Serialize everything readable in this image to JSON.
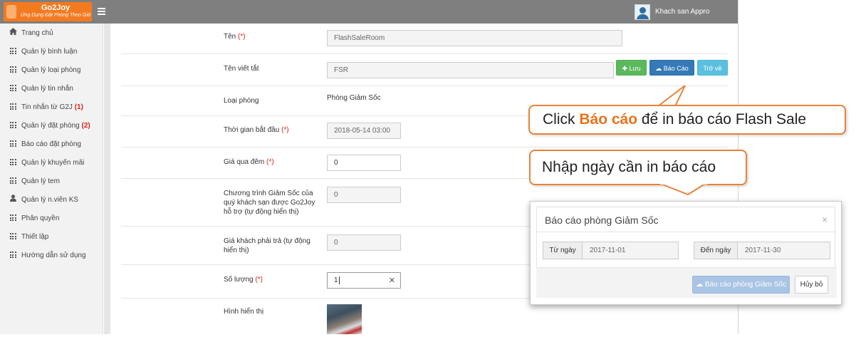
{
  "header": {
    "logo_brand": "Go2Joy",
    "logo_tagline": "Ứng Dụng Đặt Phòng Theo Giờ",
    "username": "Khach san Appro"
  },
  "sidebar": {
    "items": [
      {
        "label": "Trang chủ",
        "icon": "home-icon"
      },
      {
        "label": "Quản lý bình luận",
        "icon": "grid-icon"
      },
      {
        "label": "Quản lý loại phòng",
        "icon": "grid-icon"
      },
      {
        "label": "Quản lý tin nhắn",
        "icon": "grid-icon"
      },
      {
        "label": "Tin nhắn từ G2J",
        "badge": "(1)",
        "icon": "grid-icon"
      },
      {
        "label": "Quản lý đặt phòng",
        "badge": "(2)",
        "icon": "grid-icon"
      },
      {
        "label": "Báo cáo đặt phòng",
        "icon": "grid-icon"
      },
      {
        "label": "Quản lý khuyến mãi",
        "icon": "grid-icon"
      },
      {
        "label": "Quản lý tem",
        "icon": "grid-icon"
      },
      {
        "label": "Quản lý n.viên KS",
        "icon": "user-icon"
      },
      {
        "label": "Phân quyền",
        "icon": "grid-icon"
      },
      {
        "label": "Thiết lập",
        "icon": "grid-icon"
      },
      {
        "label": "Hướng dẫn sử dụng",
        "icon": "grid-icon"
      }
    ]
  },
  "form": {
    "name_label": "Tên",
    "name_value": "FlashSaleRoom",
    "short_name_label": "Tên viết tắt",
    "short_name_value": "FSR",
    "room_type_label": "Loại phòng",
    "room_type_value": "Phòng Giảm Sốc",
    "start_time_label": "Thời gian bắt đầu",
    "start_time_value": "2018-05-14 03:00",
    "overnight_price_label": "Giá qua đêm",
    "overnight_price_value": "0",
    "program_label_1": "Chương trình Giảm Sốc của",
    "program_label_2": "quý khách sạn được Go2Joy",
    "program_label_3": "hỗ trợ (tự động hiển thị)",
    "program_value": "0",
    "customer_pays_label_1": "Giá khách phải trả (tự động",
    "customer_pays_label_2": "hiển thị)",
    "customer_pays_value": "0",
    "quantity_label": "Số lượng",
    "quantity_value": "1",
    "image_label": "Hình hiển thị",
    "required_mark": "(*)"
  },
  "toolbar": {
    "save_label": "Lưu",
    "report_label": "Báo Cáo",
    "back_label": "Trở về"
  },
  "callouts": {
    "click_prefix": "Click ",
    "click_highlight": "Báo cáo",
    "click_suffix": " để in báo cáo Flash Sale",
    "enter_date": "Nhập ngày cần in báo cáo"
  },
  "modal": {
    "title": "Báo cáo phòng Giảm Sốc",
    "from_label": "Từ ngày",
    "from_value": "2017-11-01",
    "to_label": "Đến ngày",
    "to_value": "2017-11-30",
    "report_button": "Báo cáo phòng Giảm Sốc",
    "cancel_button": "Hủy bỏ"
  },
  "colors": {
    "accent_orange": "#f47a20",
    "callout_border": "#e8823a",
    "required_red": "#d9231d",
    "success_green": "#5cb85c",
    "primary_blue": "#337ab7",
    "info_cyan": "#5bc0de"
  }
}
